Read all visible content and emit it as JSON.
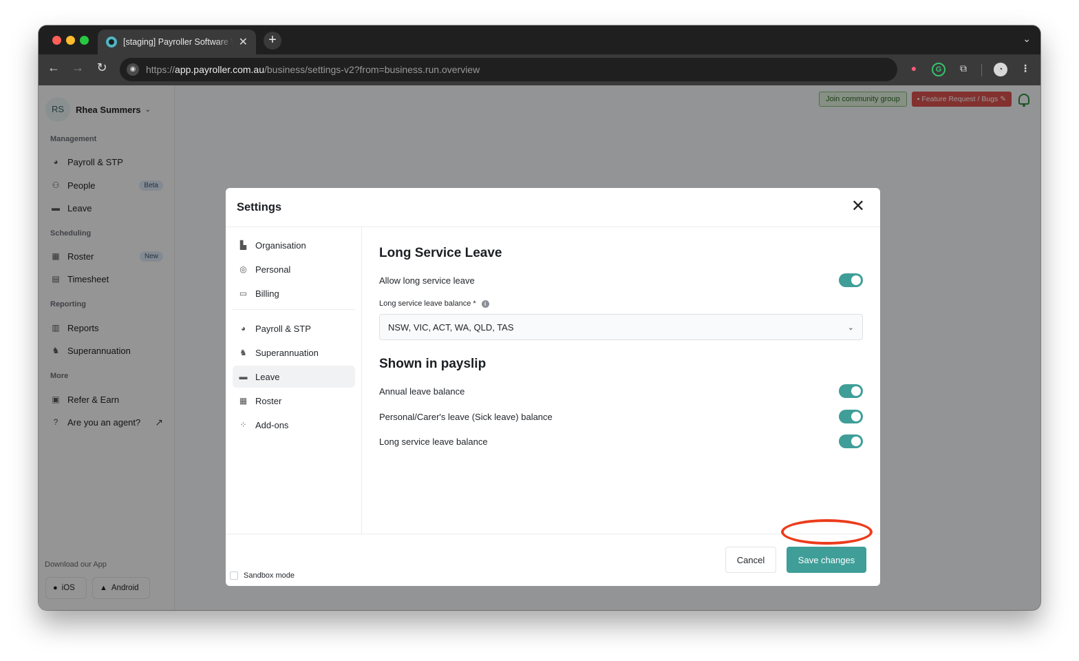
{
  "browser": {
    "tab_title": "[staging] Payroller Software Web",
    "url_prefix": "https://",
    "url_host": "app.payroller.com.au",
    "url_path": "/business/settings-v2?from=business.run.overview"
  },
  "sidebar": {
    "user_initials": "RS",
    "user_name": "Rhea Summers",
    "sections": {
      "management": "Management",
      "scheduling": "Scheduling",
      "reporting": "Reporting",
      "more": "More"
    },
    "items": {
      "payroll": "Payroll & STP",
      "people": "People",
      "people_badge": "Beta",
      "leave": "Leave",
      "roster": "Roster",
      "roster_badge": "New",
      "timesheet": "Timesheet",
      "reports": "Reports",
      "superannuation": "Superannuation",
      "refer": "Refer & Earn",
      "agent": "Are you an agent?"
    },
    "download_label": "Download our App",
    "ios": "iOS",
    "android": "Android"
  },
  "header": {
    "community": "Join community group",
    "feature": "Feature Request / Bugs"
  },
  "modal": {
    "title": "Settings",
    "nav": {
      "organisation": "Organisation",
      "personal": "Personal",
      "billing": "Billing",
      "payroll": "Payroll & STP",
      "superannuation": "Superannuation",
      "leave": "Leave",
      "roster": "Roster",
      "addons": "Add-ons"
    },
    "lsl": {
      "heading": "Long Service Leave",
      "allow_label": "Allow long service leave",
      "allow_on": true,
      "balance_label": "Long service leave balance *",
      "balance_value": "NSW, VIC, ACT, WA, QLD, TAS"
    },
    "payslip": {
      "heading": "Shown in payslip",
      "annual": "Annual leave balance",
      "personal": "Personal/Carer's leave (Sick leave) balance",
      "long_service": "Long service leave balance"
    },
    "footer": {
      "sandbox": "Sandbox mode",
      "cancel": "Cancel",
      "save": "Save changes"
    }
  },
  "colors": {
    "accent": "#3f9e98",
    "highlight": "#ec3c1c"
  }
}
